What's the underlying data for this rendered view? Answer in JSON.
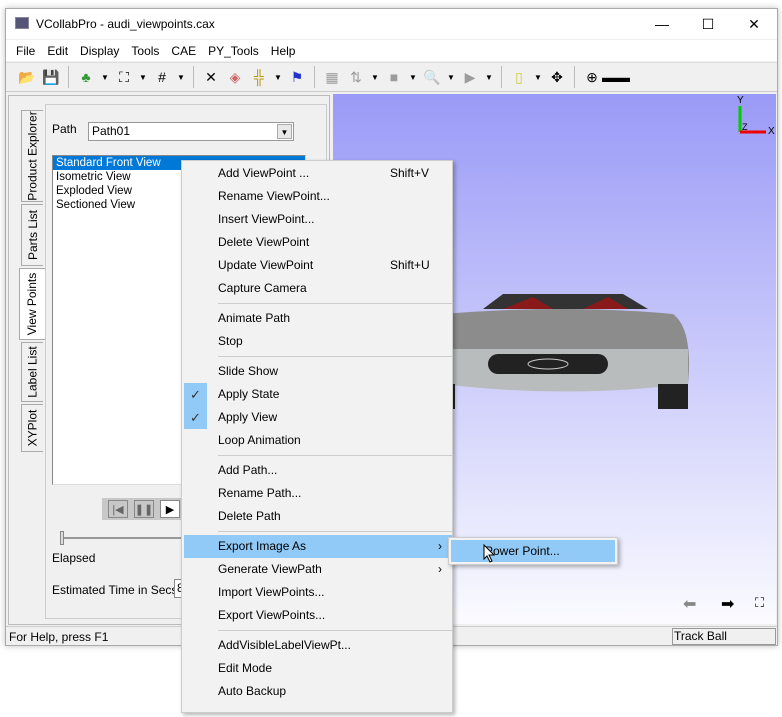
{
  "window": {
    "title": "VCollabPro - audi_viewpoints.cax",
    "minimize": "—",
    "maximize": "☐",
    "close": "✕"
  },
  "menubar": [
    "File",
    "Edit",
    "Display",
    "Tools",
    "CAE",
    "PY_Tools",
    "Help"
  ],
  "left_tabs": [
    "Product Explorer",
    "Parts List",
    "View Points",
    "Label List",
    "XYPlot"
  ],
  "viewpoints": {
    "path_label": "Path",
    "path_value": "Path01",
    "items": [
      "Standard Front View",
      "Isometric View",
      "Exploded View",
      "Sectioned View"
    ],
    "elapsed_label": "Elapsed",
    "time_label": "Estimated Time in Secs.",
    "time_value": "8"
  },
  "viewport": {
    "axis_y": "Y",
    "axis_x": "X",
    "axis_z": "Z"
  },
  "status": {
    "help": "For Help, press F1",
    "mode": "Track Ball"
  },
  "context_menu": [
    {
      "label": "Add ViewPoint ...",
      "shortcut": "Shift+V"
    },
    {
      "label": "Rename ViewPoint..."
    },
    {
      "label": "Insert ViewPoint..."
    },
    {
      "label": "Delete ViewPoint"
    },
    {
      "label": "Update ViewPoint",
      "shortcut": "Shift+U"
    },
    {
      "label": "Capture Camera"
    },
    {
      "label": "Animate Path"
    },
    {
      "label": "Stop"
    },
    {
      "label": "Slide Show"
    },
    {
      "label": "Apply State",
      "checked": true
    },
    {
      "label": "Apply View",
      "checked": true
    },
    {
      "label": "Loop Animation"
    },
    {
      "label": "Add Path..."
    },
    {
      "label": "Rename Path..."
    },
    {
      "label": "Delete Path"
    },
    {
      "label": "Export Image As",
      "submenu": true,
      "highlighted": true
    },
    {
      "label": "Generate ViewPath",
      "submenu": true
    },
    {
      "label": "Import ViewPoints..."
    },
    {
      "label": "Export ViewPoints..."
    },
    {
      "label": "AddVisibleLabelViewPt..."
    },
    {
      "label": "Edit Mode"
    },
    {
      "label": "Auto Backup"
    }
  ],
  "submenu": {
    "label": "Power Point..."
  },
  "colors": {
    "highlight": "#91c9f7",
    "selection": "#0078d7",
    "viewport_top": "#9a9af7"
  }
}
